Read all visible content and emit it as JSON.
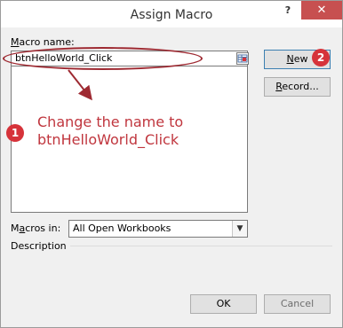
{
  "window": {
    "title": "Assign Macro",
    "help": "?",
    "close": "✕"
  },
  "macro_name": {
    "label": "Macro name:",
    "label_access_key": "M",
    "label_rest": "acro name:",
    "value": "btnHelloWorld_Click"
  },
  "buttons": {
    "new": "New",
    "new_key": "N",
    "new_rest": "ew",
    "record": "Record...",
    "record_key": "R",
    "record_rest": "ecord...",
    "ok": "OK",
    "cancel": "Cancel"
  },
  "macros_in": {
    "label": "Macros in:",
    "label_pre": "M",
    "label_key": "a",
    "label_rest": "cros in:",
    "value": "All Open Workbooks"
  },
  "description": {
    "label": "Description"
  },
  "annotations": {
    "badge1": "1",
    "badge2": "2",
    "text_line1": "Change the name to",
    "text_line2": "btnHelloWorld_Click",
    "accent_color": "#d6333a"
  }
}
